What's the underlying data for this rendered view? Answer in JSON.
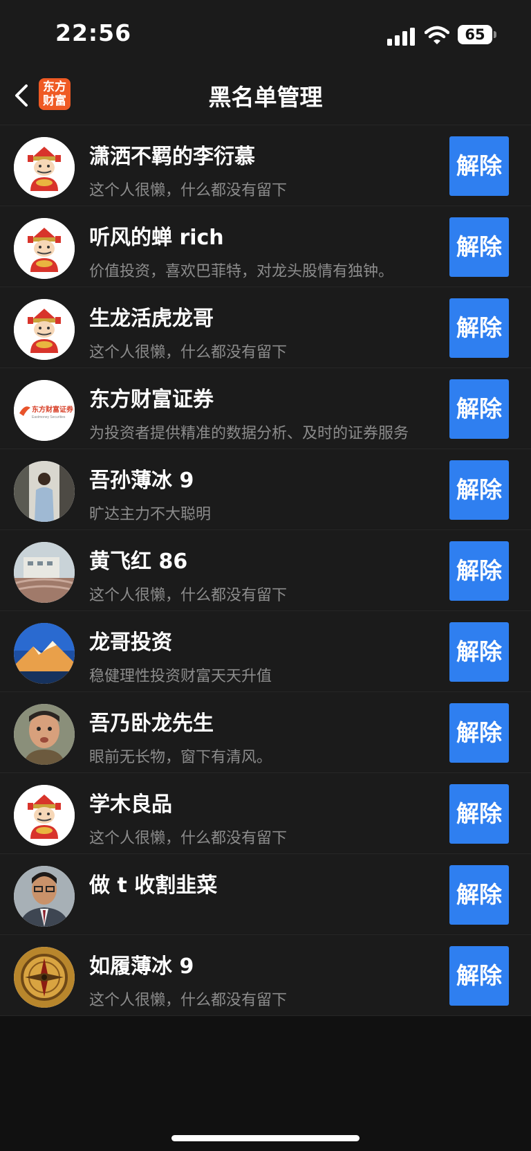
{
  "status_bar": {
    "time": "22:56",
    "battery": "65"
  },
  "nav": {
    "title": "黑名单管理",
    "logo_text": "东方财富"
  },
  "rows": [
    {
      "name": "潇洒不羁的李衍慕",
      "bio": "这个人很懒，什么都没有留下",
      "button": "解除",
      "avatar": "caishen-avatar"
    },
    {
      "name": "听风的蝉 rich",
      "bio": "价值投资，喜欢巴菲特，对龙头股情有独钟。",
      "button": "解除",
      "avatar": "caishen-avatar"
    },
    {
      "name": "生龙活虎龙哥",
      "bio": "这个人很懒，什么都没有留下",
      "button": "解除",
      "avatar": "caishen-avatar"
    },
    {
      "name": "东方财富证券",
      "bio": "为投资者提供精准的数据分析、及时的证券服务",
      "button": "解除",
      "avatar": "eastmoney-securities-logo",
      "avatar_logo_cn": "东方财富证券",
      "avatar_logo_en": "Eastmoney Securities"
    },
    {
      "name": "吾孙薄冰 9",
      "bio": "旷达主力不大聪明",
      "button": "解除",
      "avatar": "person-photo-avatar"
    },
    {
      "name": "黄飞红 86",
      "bio": "这个人很懒，什么都没有留下",
      "button": "解除",
      "avatar": "building-photo-avatar"
    },
    {
      "name": "龙哥投资",
      "bio": "稳健理性投资财富天天升值",
      "button": "解除",
      "avatar": "mountain-photo-avatar"
    },
    {
      "name": "吾乃卧龙先生",
      "bio": "眼前无长物，窗下有清风。",
      "button": "解除",
      "avatar": "face-photo-avatar"
    },
    {
      "name": "学木良品",
      "bio": "这个人很懒，什么都没有留下",
      "button": "解除",
      "avatar": "caishen-avatar"
    },
    {
      "name": "做 t 收割韭菜",
      "bio": "",
      "button": "解除",
      "avatar": "suited-man-photo-avatar"
    },
    {
      "name": "如履薄冰 9",
      "bio": "这个人很懒，什么都没有留下",
      "button": "解除",
      "avatar": "compass-photo-avatar"
    }
  ]
}
